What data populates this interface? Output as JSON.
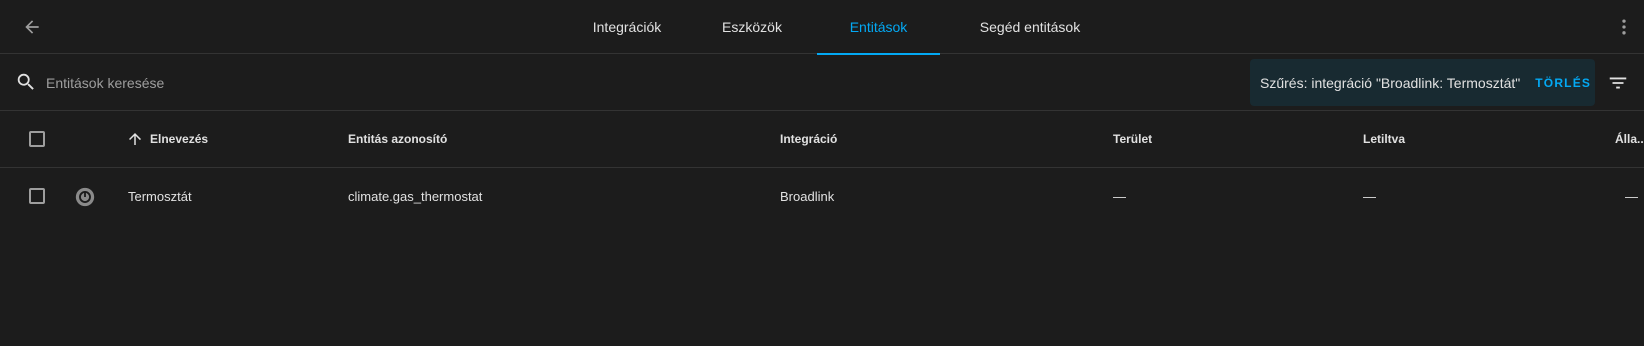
{
  "header": {
    "tabs": [
      {
        "label": "Integrációk",
        "active": false
      },
      {
        "label": "Eszközök",
        "active": false
      },
      {
        "label": "Entitások",
        "active": true
      },
      {
        "label": "Segéd entitások",
        "active": false
      }
    ],
    "icons": {
      "back": "arrow-left-icon",
      "menu": "dots-vertical-icon"
    }
  },
  "search": {
    "placeholder": "Entitások keresése",
    "value": ""
  },
  "filter": {
    "text": "Szűrés: integráció \"Broadlink: Termosztát\"",
    "clear_label": "TÖRLÉS"
  },
  "table": {
    "columns": [
      {
        "key": "name",
        "label": "Elnevezés",
        "sorted": "ascending"
      },
      {
        "key": "entity_id",
        "label": "Entitás azonosító"
      },
      {
        "key": "integration",
        "label": "Integráció"
      },
      {
        "key": "area",
        "label": "Terület"
      },
      {
        "key": "disabled",
        "label": "Letiltva"
      },
      {
        "key": "status",
        "label": "Álla..."
      }
    ],
    "rows": [
      {
        "name": "Termosztát",
        "entity_id": "climate.gas_thermostat",
        "integration": "Broadlink",
        "area": "—",
        "disabled": "—",
        "status": "—"
      }
    ]
  },
  "colors": {
    "background": "#1c1c1c",
    "accent": "#03a9f4",
    "filter_chip_bg": "#182a31",
    "divider": "#333333"
  }
}
